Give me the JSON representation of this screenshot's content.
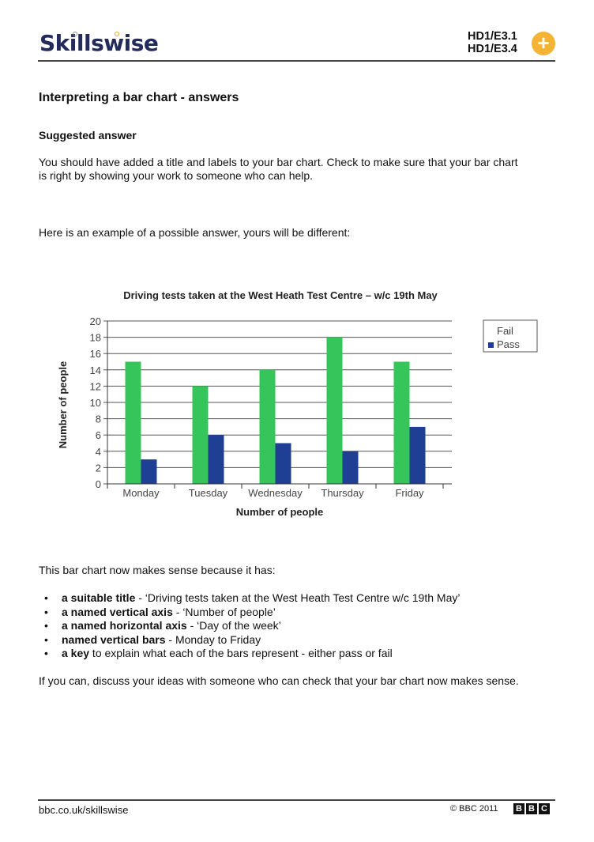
{
  "header": {
    "logo_text": "Skillswise",
    "codes": [
      "HD1/E3.1",
      "HD1/E3.4"
    ],
    "badge_icon": "plus-icon",
    "badge_color": "#f5b335"
  },
  "page": {
    "title": "Interpreting a bar chart - answers",
    "subtitle": "Suggested answer",
    "intro_line1": "You should have added a title and labels to your bar chart. Check to make sure that your bar chart",
    "intro_line2": "is right by showing your work to someone who can help.",
    "example_text": "Here is an example of a possible answer, yours will be different:",
    "makes_sense_text": "This bar chart now makes sense because it has:",
    "bullets": [
      {
        "bold": "a suitable title",
        "text": " - ‘Driving tests taken at the West Heath Test Centre w/c 19th May’"
      },
      {
        "bold": "a named vertical axis",
        "text": " - ‘Number of people’"
      },
      {
        "bold": "a named horizontal axis",
        "text": " - ‘Day of the week’"
      },
      {
        "bold": "named vertical bars",
        "text": " - Monday to Friday"
      },
      {
        "bold": "a key",
        "text": " to explain what each of the bars represent - either pass or fail"
      }
    ],
    "closing_text": "If you can, discuss your ideas with someone who can check that your bar chart now makes sense."
  },
  "footer": {
    "url": "bbc.co.uk/skillswise",
    "copyright": "© BBC 2011",
    "bbc_blocks": [
      "B",
      "B",
      "C"
    ]
  },
  "chart_data": {
    "type": "bar",
    "title": "Driving tests taken at the West Heath Test Centre – w/c 19th May",
    "xlabel": "Number of people",
    "ylabel": "Number of people",
    "categories": [
      "Monday",
      "Tuesday",
      "Wednesday",
      "Thursday",
      "Friday"
    ],
    "series": [
      {
        "name": "Fail",
        "color": "#35c55a",
        "values": [
          15,
          12,
          14,
          18,
          15
        ]
      },
      {
        "name": "Pass",
        "color": "#1f3f94",
        "values": [
          3,
          6,
          5,
          4,
          7
        ]
      }
    ],
    "ylim": [
      0,
      20
    ],
    "yticks": [
      0,
      2,
      4,
      6,
      8,
      10,
      12,
      14,
      16,
      18,
      20
    ],
    "grid": true,
    "legend": {
      "position": "right",
      "entries": [
        {
          "label": "Fail",
          "swatch_visible": false
        },
        {
          "label": "Pass",
          "swatch_visible": true
        }
      ]
    }
  }
}
